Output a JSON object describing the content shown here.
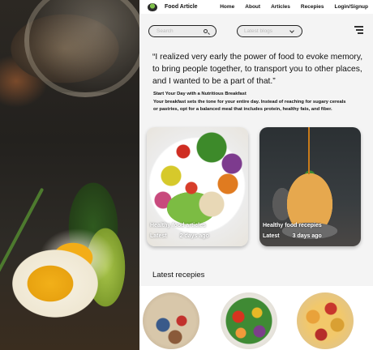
{
  "nav": {
    "brand": "Food Article",
    "links": [
      "Home",
      "About",
      "Articles",
      "Recepies",
      "Login/Signup"
    ]
  },
  "search": {
    "placeholder": "Search"
  },
  "filter": {
    "selected": "Latest blogs"
  },
  "article": {
    "quote": "“I realized very early the power of food to evoke memory, to bring people together, to transport you to other places, and I wanted to be a part of that.”",
    "subhead": "Start Your Day with a Nutritious Breakfast",
    "body": "Your breakfast sets the tone for your entire day. Instead of reaching for sugary cereals or pastries, opt for a balanced meal that includes protein, healthy fats, and fiber."
  },
  "cards": [
    {
      "title": "Healthy food articles",
      "tag": "Latest",
      "age": "2 days ago"
    },
    {
      "title": "Healthy  food recepies",
      "tag": "Latest",
      "age": "3 days ago"
    }
  ],
  "latest": {
    "heading": "Latest recepies"
  },
  "icons": {
    "logo": "food-bowl-icon",
    "search": "search-icon",
    "select": "chevron-down-icon",
    "menu": "hamburger-menu-icon"
  }
}
